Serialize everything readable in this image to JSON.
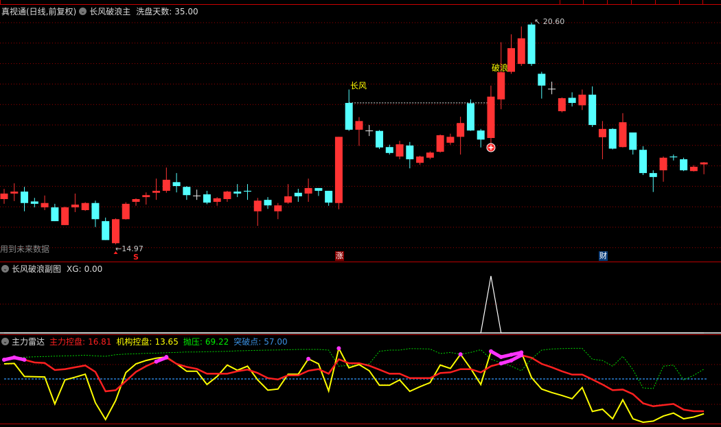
{
  "main_header": {
    "title": "真视通(日线,前复权)",
    "indicator": "长风破浪主",
    "param_label": "洗盘天数:",
    "param_value": "35.00"
  },
  "main_chart": {
    "low_label": "14.97",
    "high_label": "20.60",
    "future_data_note": "用到未来数据",
    "signal_changfeng": "长风",
    "signal_polang": "破浪",
    "marker_s": "S",
    "marker_zhang": "涨",
    "marker_cai": "财",
    "colors": {
      "up": "#ff3333",
      "down": "#54ffff",
      "grid": "#a00000",
      "signal": "#ffff00"
    }
  },
  "sub1_header": {
    "indicator": "长风破浪副图",
    "xg_label": "XG:",
    "xg_value": "0.00"
  },
  "sub2_header": {
    "indicator": "主力雷达",
    "l1": "主力控盘:",
    "v1": "16.81",
    "l2": "机构控盘:",
    "v2": "13.65",
    "l3": "抛压:",
    "v3": "69.22",
    "l4": "突破点:",
    "v4": "57.00"
  },
  "chart_data": [
    {
      "type": "candlestick",
      "title": "真视通(日线,前复权)",
      "y_range": [
        14.97,
        20.6
      ],
      "ohlc": [
        [
          16.12,
          16.38,
          16.0,
          16.26
        ],
        [
          16.26,
          16.52,
          16.07,
          16.31
        ],
        [
          16.31,
          16.43,
          15.81,
          16.02
        ],
        [
          16.06,
          16.15,
          15.91,
          16.0
        ],
        [
          15.91,
          16.21,
          15.84,
          16.02
        ],
        [
          15.91,
          16.0,
          15.56,
          15.56
        ],
        [
          15.46,
          15.93,
          15.46,
          15.91
        ],
        [
          15.91,
          16.26,
          15.79,
          15.98
        ],
        [
          15.84,
          16.04,
          15.82,
          16.02
        ],
        [
          16.02,
          16.08,
          15.41,
          15.61
        ],
        [
          15.56,
          15.65,
          15.08,
          15.08
        ],
        [
          15.0,
          15.63,
          14.97,
          15.61
        ],
        [
          15.61,
          16.04,
          15.6,
          16.0
        ],
        [
          16.05,
          16.14,
          15.95,
          16.12
        ],
        [
          16.17,
          16.29,
          15.98,
          16.22
        ],
        [
          16.28,
          16.64,
          16.1,
          16.33
        ],
        [
          16.33,
          16.92,
          16.28,
          16.61
        ],
        [
          16.55,
          16.78,
          16.29,
          16.45
        ],
        [
          16.43,
          16.45,
          16.1,
          16.22
        ],
        [
          16.21,
          16.36,
          16.1,
          16.21
        ],
        [
          16.24,
          16.33,
          15.99,
          16.03
        ],
        [
          16.05,
          16.17,
          15.95,
          16.14
        ],
        [
          16.12,
          16.33,
          16.05,
          16.31
        ],
        [
          16.31,
          16.5,
          16.17,
          16.26
        ],
        [
          16.33,
          16.5,
          16.1,
          16.31
        ],
        [
          15.81,
          16.15,
          15.44,
          16.08
        ],
        [
          16.1,
          16.17,
          15.87,
          15.96
        ],
        [
          15.81,
          16.02,
          15.61,
          15.96
        ],
        [
          16.03,
          16.5,
          16.0,
          16.19
        ],
        [
          16.28,
          16.38,
          16.05,
          16.19
        ],
        [
          16.26,
          16.64,
          16.05,
          16.4
        ],
        [
          16.4,
          16.4,
          16.2,
          16.33
        ],
        [
          16.33,
          16.33,
          15.95,
          16.03
        ],
        [
          16.02,
          17.7,
          15.86,
          17.7
        ],
        [
          18.56,
          18.9,
          17.85,
          17.88
        ],
        [
          17.88,
          18.2,
          17.47,
          18.1
        ],
        [
          17.86,
          18.0,
          17.72,
          17.86
        ],
        [
          17.85,
          17.87,
          17.39,
          17.43
        ],
        [
          17.44,
          17.5,
          17.25,
          17.29
        ],
        [
          17.2,
          17.6,
          17.13,
          17.51
        ],
        [
          17.48,
          17.57,
          16.9,
          17.13
        ],
        [
          17.04,
          17.22,
          16.99,
          17.2
        ],
        [
          17.17,
          17.33,
          17.13,
          17.3
        ],
        [
          17.32,
          17.76,
          17.3,
          17.74
        ],
        [
          17.55,
          17.78,
          17.5,
          17.7
        ],
        [
          17.7,
          18.21,
          17.25,
          18.05
        ],
        [
          18.55,
          18.65,
          17.85,
          17.86
        ],
        [
          17.86,
          17.9,
          17.43,
          17.63
        ],
        [
          17.67,
          19.0,
          17.51,
          18.72
        ],
        [
          18.65,
          20.1,
          18.4,
          19.34
        ],
        [
          19.35,
          20.3,
          19.3,
          19.95
        ],
        [
          19.55,
          20.5,
          19.5,
          20.2
        ],
        [
          20.55,
          20.6,
          19.5,
          19.55
        ],
        [
          19.3,
          19.35,
          18.67,
          19.0
        ],
        [
          18.92,
          19.1,
          18.78,
          18.92
        ],
        [
          18.35,
          18.7,
          18.32,
          18.68
        ],
        [
          18.69,
          18.83,
          18.47,
          18.56
        ],
        [
          18.5,
          18.9,
          18.38,
          18.77
        ],
        [
          18.77,
          18.98,
          17.95,
          18.0
        ],
        [
          17.69,
          18.1,
          17.13,
          17.9
        ],
        [
          17.9,
          17.92,
          17.38,
          17.4
        ],
        [
          17.44,
          18.3,
          17.43,
          18.07
        ],
        [
          17.81,
          17.81,
          17.25,
          17.37
        ],
        [
          17.37,
          17.46,
          16.73,
          16.78
        ],
        [
          16.78,
          16.85,
          16.3,
          16.68
        ],
        [
          16.85,
          17.2,
          16.56,
          17.17
        ],
        [
          17.2,
          17.25,
          17.1,
          17.18
        ],
        [
          17.13,
          17.17,
          16.83,
          16.85
        ],
        [
          16.83,
          16.98,
          16.82,
          16.94
        ],
        [
          17.0,
          17.06,
          16.75,
          17.05
        ]
      ],
      "signals": {
        "changfeng_index": 34,
        "polang_index": 48,
        "buy_circle_index": 48,
        "s_index": 11,
        "zhang_index": 33,
        "cai_index": 59,
        "dash_line_price": 18.56
      }
    },
    {
      "type": "line",
      "title": "长风破浪副图",
      "y_range": [
        0,
        1
      ],
      "series": [
        {
          "name": "XG",
          "spike_index": 48,
          "spike_value": 1,
          "count": 70
        }
      ]
    },
    {
      "type": "line",
      "title": "主力雷达",
      "y_range": [
        1,
        97
      ],
      "series": [
        {
          "name": "主力控盘",
          "color": "#ff2020",
          "highlight_indices": [
            0,
            1,
            2,
            15,
            16,
            49,
            50,
            51
          ],
          "values": [
            80.9,
            83.7,
            80.9,
            77.5,
            76.9,
            68.1,
            69.2,
            71.5,
            73.8,
            65.8,
            41.6,
            43.0,
            54.4,
            65.8,
            72.9,
            78.6,
            83.7,
            75.8,
            72.0,
            69.5,
            63.5,
            63.5,
            63.5,
            66.6,
            68.6,
            64.4,
            58.1,
            56.4,
            61.5,
            61.5,
            67.2,
            69.2,
            63.5,
            81.5,
            76.6,
            76.6,
            73.5,
            68.6,
            63.5,
            63.5,
            58.1,
            58.1,
            58.1,
            64.4,
            65.2,
            69.2,
            69.2,
            65.2,
            72.9,
            76.3,
            80.0,
            86.6,
            83.4,
            75.8,
            71.5,
            66.6,
            62.4,
            62.4,
            56.4,
            50.1,
            43.0,
            43.8,
            38.1,
            26.7,
            23.0,
            24.5,
            25.9,
            18.8,
            16.8,
            16.81
          ]
        },
        {
          "name": "机构控盘",
          "color": "#ffff00",
          "highlight_indices": [
            16,
            30,
            33,
            45,
            48,
            49,
            50,
            51
          ],
          "values": [
            75.8,
            76.3,
            60.1,
            59.8,
            59.5,
            25.9,
            55.8,
            59.2,
            62.9,
            27.3,
            6.5,
            30.2,
            64.9,
            75.8,
            80.0,
            82.9,
            84.3,
            75.8,
            66.6,
            66.6,
            50.1,
            60.1,
            74.3,
            67.8,
            72.9,
            55.8,
            43.0,
            44.4,
            62.9,
            62.9,
            82.0,
            75.8,
            42.1,
            95.1,
            70.9,
            74.9,
            67.2,
            49.2,
            49.2,
            55.8,
            41.6,
            47.3,
            52.4,
            74.3,
            70.1,
            87.7,
            70.1,
            50.1,
            91.4,
            84.3,
            87.2,
            90.0,
            58.7,
            44.4,
            40.1,
            36.4,
            32.4,
            46.4,
            16.5,
            19.3,
            7.4,
            31.0,
            7.4,
            3.1,
            4.5,
            10.8,
            14.5,
            7.4,
            9.6,
            13.65
          ]
        },
        {
          "name": "抛压",
          "color": "#00dd00",
          "values": [
            82.3,
            83.4,
            84.0,
            84.6,
            84.9,
            85.4,
            85.7,
            86.0,
            86.6,
            85.7,
            85.2,
            87.2,
            88.0,
            88.3,
            88.9,
            89.1,
            89.7,
            90.0,
            90.6,
            90.6,
            90.9,
            91.1,
            91.4,
            92.0,
            92.3,
            92.6,
            92.9,
            93.1,
            93.4,
            93.7,
            93.7,
            93.7,
            92.9,
            72.9,
            73.8,
            74.3,
            75.8,
            91.4,
            92.9,
            92.9,
            94.8,
            94.6,
            94.3,
            88.6,
            90.0,
            87.7,
            90.0,
            93.4,
            81.5,
            77.2,
            72.9,
            67.2,
            82.0,
            92.9,
            94.3,
            94.8,
            95.1,
            95.1,
            81.5,
            80.0,
            72.9,
            85.2,
            68.6,
            45.8,
            45.0,
            72.9,
            74.3,
            55.8,
            61.5,
            69.22
          ]
        },
        {
          "name": "突破点",
          "color": "#3399ff",
          "constant": 57.0
        }
      ]
    }
  ]
}
